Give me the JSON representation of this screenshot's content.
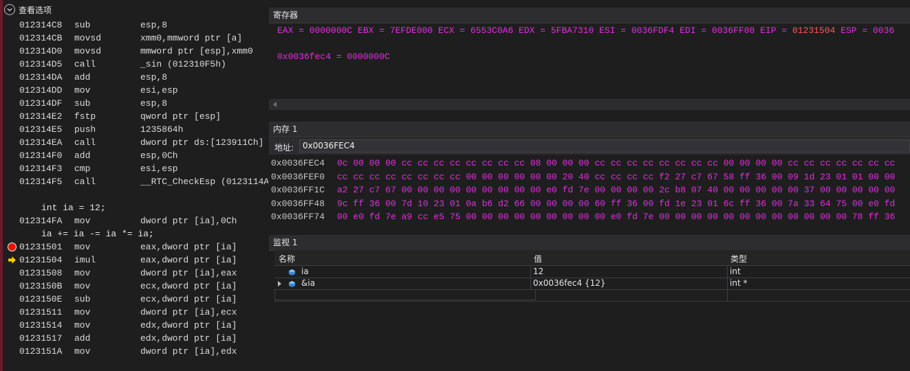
{
  "disassembly": {
    "toolbar_label": "查看选项",
    "lines": [
      {
        "addr": "012314C8",
        "mnemonic": "sub",
        "operands": "esp,8"
      },
      {
        "addr": "012314CB",
        "mnemonic": "movsd",
        "operands": "xmm0,mmword ptr [a]"
      },
      {
        "addr": "012314D0",
        "mnemonic": "movsd",
        "operands": "mmword ptr [esp],xmm0"
      },
      {
        "addr": "012314D5",
        "mnemonic": "call",
        "operands": "_sin (012310F5h)"
      },
      {
        "addr": "012314DA",
        "mnemonic": "add",
        "operands": "esp,8"
      },
      {
        "addr": "012314DD",
        "mnemonic": "mov",
        "operands": "esi,esp"
      },
      {
        "addr": "012314DF",
        "mnemonic": "sub",
        "operands": "esp,8"
      },
      {
        "addr": "012314E2",
        "mnemonic": "fstp",
        "operands": "qword ptr [esp]"
      },
      {
        "addr": "012314E5",
        "mnemonic": "push",
        "operands": "1235864h"
      },
      {
        "addr": "012314EA",
        "mnemonic": "call",
        "operands": "dword ptr ds:[123911Ch]"
      },
      {
        "addr": "012314F0",
        "mnemonic": "add",
        "operands": "esp,0Ch"
      },
      {
        "addr": "012314F3",
        "mnemonic": "cmp",
        "operands": "esi,esp"
      },
      {
        "addr": "012314F5",
        "mnemonic": "call",
        "operands": "__RTC_CheckEsp (0123114A"
      },
      {
        "blank": true
      },
      {
        "source": "int ia = 12;"
      },
      {
        "addr": "012314FA",
        "mnemonic": "mov",
        "operands": "dword ptr [ia],0Ch"
      },
      {
        "source": "ia += ia -= ia *= ia;"
      },
      {
        "addr": "01231501",
        "mnemonic": "mov",
        "operands": "eax,dword ptr [ia]",
        "glyph": "breakpoint"
      },
      {
        "addr": "01231504",
        "mnemonic": "imul",
        "operands": "eax,dword ptr [ia]",
        "glyph": "current"
      },
      {
        "addr": "01231508",
        "mnemonic": "mov",
        "operands": "dword ptr [ia],eax"
      },
      {
        "addr": "0123150B",
        "mnemonic": "mov",
        "operands": "ecx,dword ptr [ia]"
      },
      {
        "addr": "0123150E",
        "mnemonic": "sub",
        "operands": "ecx,dword ptr [ia]"
      },
      {
        "addr": "01231511",
        "mnemonic": "mov",
        "operands": "dword ptr [ia],ecx"
      },
      {
        "addr": "01231514",
        "mnemonic": "mov",
        "operands": "edx,dword ptr [ia]"
      },
      {
        "addr": "01231517",
        "mnemonic": "add",
        "operands": "edx,dword ptr [ia]"
      },
      {
        "addr": "0123151A",
        "mnemonic": "mov",
        "operands": "dword ptr [ia],edx"
      }
    ]
  },
  "registers": {
    "title": "寄存器",
    "line_before_eip": "EAX = 0000000C EBX = 7EFDE000 ECX = 6553C0A6 EDX = 5FBA7310 ESI = 0036FDF4 EDI = 0036FF08 EIP = ",
    "eip_value": "01231504",
    "line_after_eip": " ESP = 0036",
    "watch_line": "0x0036fec4 = 0000000C",
    "colors": {
      "value": "#e030e0",
      "changed": "#ff5a5a"
    }
  },
  "memory": {
    "title": "内存 1",
    "address_label": "地址:",
    "address_value": "0x0036FEC4",
    "rows": [
      {
        "addr": "0x0036FEC4",
        "bytes": "0c 00 00 00 cc cc cc cc cc cc cc cc 08 00 00 00 cc cc cc cc cc cc cc cc 00 00 00 00 cc cc cc cc cc cc cc"
      },
      {
        "addr": "0x0036FEF0",
        "bytes": "cc cc cc cc cc cc cc cc 00 00 00 00 00 00 20 40 cc cc cc cc f2 27 c7 67 58 ff 36 00 09 1d 23 01 01 00 00"
      },
      {
        "addr": "0x0036FF1C",
        "bytes": "a2 27 c7 67 00 00 00 00 00 00 00 00 00 e0 fd 7e 00 00 00 00 2c b8 07 40 00 00 00 00 00 37 00 00 00 00 00"
      },
      {
        "addr": "0x0036FF48",
        "bytes": "9c ff 36 00 7d 10 23 01 0a b6 d2 66 00 00 00 00 60 ff 36 00 fd 1e 23 01 6c ff 36 00 7a 33 64 75 00 e0 fd"
      },
      {
        "addr": "0x0036FF74",
        "bytes": "00 e0 fd 7e a9 cc e5 75 00 00 00 00 00 00 00 00 00 e0 fd 7e 00 00 00 00 00 00 00 00 00 00 00 00 78 ff 36"
      }
    ]
  },
  "watch": {
    "title": "监视 1",
    "columns": {
      "name": "名称",
      "value": "值",
      "type": "类型"
    },
    "rows": [
      {
        "name": "ia",
        "value": "12",
        "type": "int",
        "expandable": false
      },
      {
        "name": "&ia",
        "value": "0x0036fec4 {12}",
        "type": "int *",
        "expandable": true
      }
    ]
  }
}
